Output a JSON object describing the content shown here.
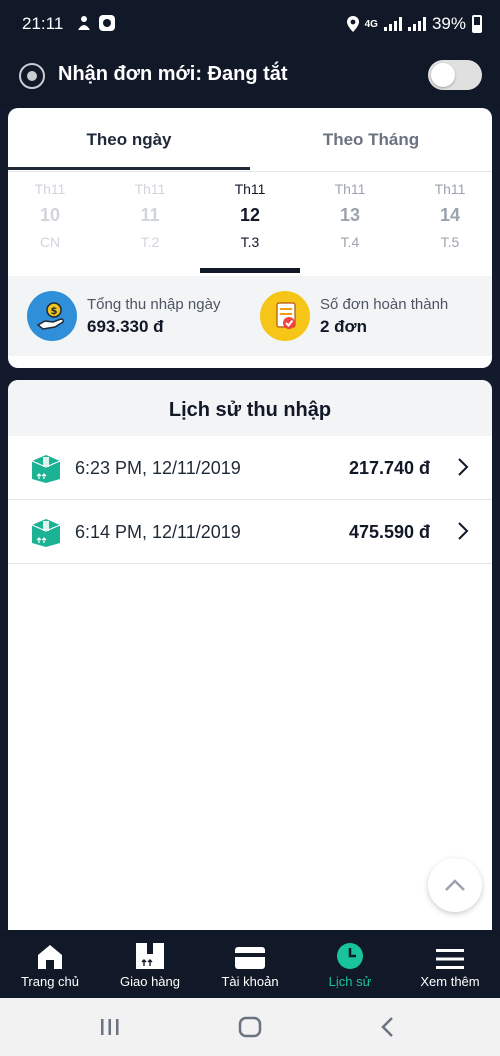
{
  "status_bar": {
    "time": "21:11",
    "network": "4G",
    "battery": "39%"
  },
  "header": {
    "title": "Nhận đơn mới: Đang tắt",
    "toggle_on": false
  },
  "tabs": [
    {
      "label": "Theo ngày",
      "active": true
    },
    {
      "label": "Theo Tháng",
      "active": false
    }
  ],
  "days": [
    {
      "month": "Th11",
      "day": "10",
      "weekday": "CN"
    },
    {
      "month": "Th11",
      "day": "11",
      "weekday": "T.2"
    },
    {
      "month": "Th11",
      "day": "12",
      "weekday": "T.3",
      "selected": true
    },
    {
      "month": "Th11",
      "day": "13",
      "weekday": "T.4"
    },
    {
      "month": "Th11",
      "day": "14",
      "weekday": "T.5"
    }
  ],
  "summary": {
    "income": {
      "label": "Tổng thu nhập ngày",
      "value": "693.330 đ",
      "icon": "money-hand-icon"
    },
    "orders": {
      "label": "Số đơn hoàn thành",
      "value": "2 đơn",
      "icon": "document-check-icon"
    }
  },
  "history": {
    "title": "Lịch sử thu nhập",
    "rows": [
      {
        "datetime": "6:23 PM, 12/11/2019",
        "amount": "217.740 đ"
      },
      {
        "datetime": "6:14 PM, 12/11/2019",
        "amount": "475.590 đ"
      }
    ]
  },
  "bottom_nav": [
    {
      "label": "Trang chủ",
      "icon": "home-icon"
    },
    {
      "label": "Giao hàng",
      "icon": "package-icon"
    },
    {
      "label": "Tài khoản",
      "icon": "card-icon"
    },
    {
      "label": "Lịch sử",
      "icon": "clock-icon",
      "active": true
    },
    {
      "label": "Xem thêm",
      "icon": "menu-icon"
    }
  ],
  "colors": {
    "dark": "#111827",
    "accent": "#19c39c",
    "coin_blue": "#2f8fd8",
    "doc_yellow": "#f5c518"
  }
}
